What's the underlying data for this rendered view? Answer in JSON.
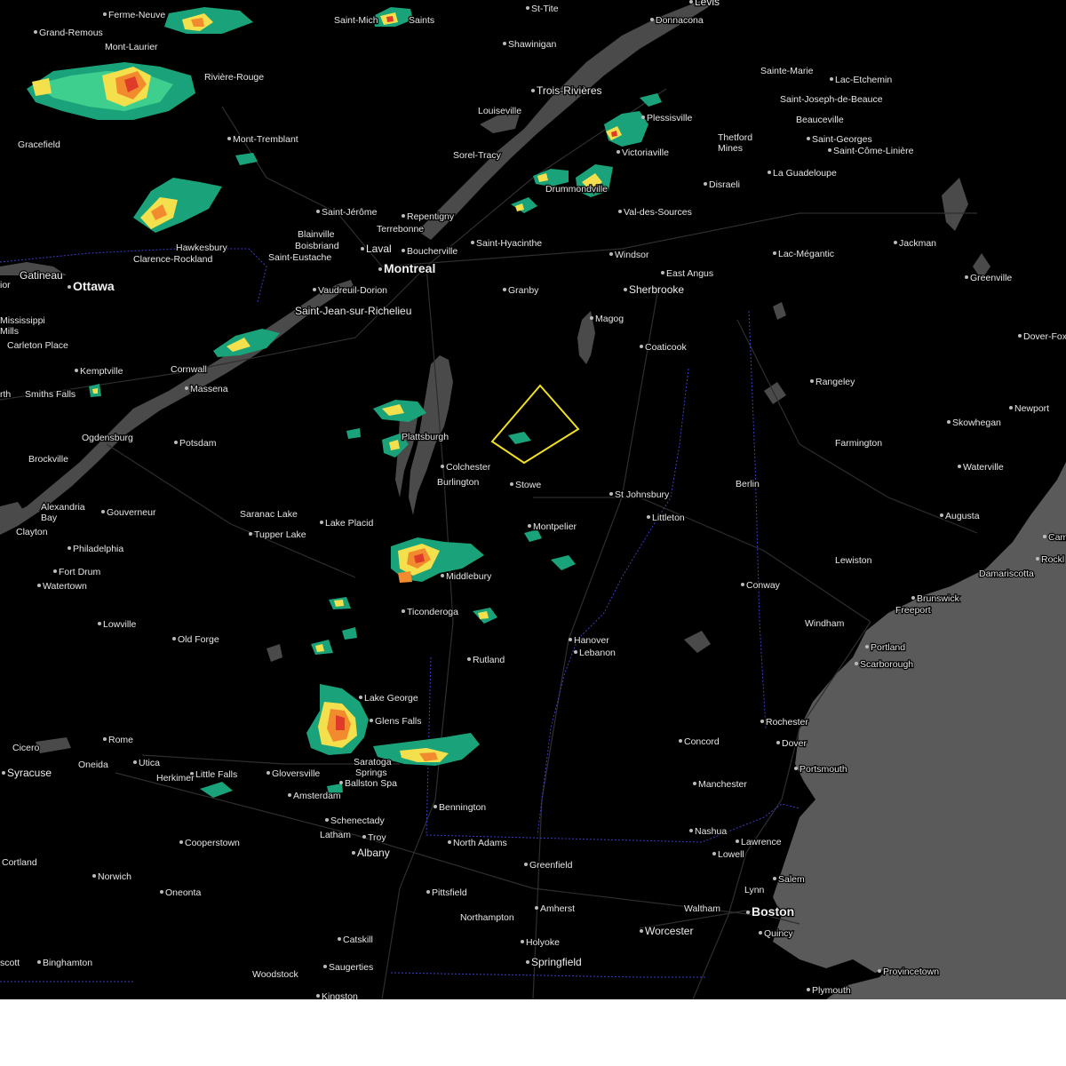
{
  "map": {
    "warning_polygon_color": "#f0e020",
    "radar_palette": {
      "light": "#1aa37a",
      "mid": "#3ecf8e",
      "yellow": "#f4e04d",
      "orange": "#f28a2e",
      "red": "#e03a2a"
    },
    "colors": {
      "land": "#000000",
      "ocean": "#5a5a5a",
      "water": "#4a4a4a",
      "roads": "#3a3a3a",
      "border": "#3c3cc8"
    }
  },
  "places": [
    {
      "id": "levis",
      "name": "Levis"
    },
    {
      "id": "ferme-neuve",
      "name": "Ferme-Neuve"
    },
    {
      "id": "saint-michel",
      "name": "Saint-Mich"
    },
    {
      "id": "saints",
      "name": "Saints"
    },
    {
      "id": "st-tite",
      "name": "St-Tite"
    },
    {
      "id": "donnacona",
      "name": "Donnacona"
    },
    {
      "id": "grand-remous",
      "name": "Grand-Remous"
    },
    {
      "id": "mont-laurier",
      "name": "Mont-Laurier"
    },
    {
      "id": "shawinigan",
      "name": "Shawinigan"
    },
    {
      "id": "sainte-marie",
      "name": "Sainte-Marie"
    },
    {
      "id": "lac-etchemin",
      "name": "Lac-Etchemin"
    },
    {
      "id": "riviere-rouge",
      "name": "Rivière-Rouge"
    },
    {
      "id": "trois-rivieres",
      "name": "Trois-Rivières"
    },
    {
      "id": "saint-joseph",
      "name": "Saint-Joseph-de-Beauce"
    },
    {
      "id": "louiseville",
      "name": "Louiseville"
    },
    {
      "id": "plessisville",
      "name": "Plessisville"
    },
    {
      "id": "beauceville",
      "name": "Beauceville"
    },
    {
      "id": "mont-tremblant",
      "name": "Mont-Tremblant"
    },
    {
      "id": "thetford",
      "name": "Thetford"
    },
    {
      "id": "mines",
      "name": "Mines"
    },
    {
      "id": "saint-georges",
      "name": "Saint-Georges"
    },
    {
      "id": "gracefield",
      "name": "Gracefield"
    },
    {
      "id": "saint-come",
      "name": "Saint-Côme-Linière"
    },
    {
      "id": "victoriaville",
      "name": "Victoriaville"
    },
    {
      "id": "sorel-tracy",
      "name": "Sorel-Tracy"
    },
    {
      "id": "la-guadeloupe",
      "name": "La Guadeloupe"
    },
    {
      "id": "drummondville",
      "name": "Drummondville"
    },
    {
      "id": "disraeli",
      "name": "Disraeli"
    },
    {
      "id": "saint-jerome",
      "name": "Saint-Jérôme"
    },
    {
      "id": "val-des-sources",
      "name": "Val-des-Sources"
    },
    {
      "id": "repentigny",
      "name": "Repentigny"
    },
    {
      "id": "terrebonne",
      "name": "Terrebonne"
    },
    {
      "id": "blainville",
      "name": "Blainville"
    },
    {
      "id": "saint-hyacinthe",
      "name": "Saint-Hyacinthe"
    },
    {
      "id": "boisbriand",
      "name": "Boisbriand"
    },
    {
      "id": "laval",
      "name": "Laval"
    },
    {
      "id": "boucherville",
      "name": "Boucherville"
    },
    {
      "id": "hawkesbury",
      "name": "Hawkesbury"
    },
    {
      "id": "jackman",
      "name": "Jackman"
    },
    {
      "id": "windsor",
      "name": "Windsor"
    },
    {
      "id": "lac-megantic",
      "name": "Lac-Mégantic"
    },
    {
      "id": "clarence-rockland",
      "name": "Clarence-Rockland"
    },
    {
      "id": "saint-eustache",
      "name": "Saint-Eustache"
    },
    {
      "id": "gatineau",
      "name": "Gatineau"
    },
    {
      "id": "montreal",
      "name": "Montreal"
    },
    {
      "id": "east-angus",
      "name": "East Angus"
    },
    {
      "id": "greenville",
      "name": "Greenville"
    },
    {
      "id": "ottawa",
      "name": "Ottawa"
    },
    {
      "id": "vaudreuil",
      "name": "Vaudreuil-Dorion"
    },
    {
      "id": "granby",
      "name": "Granby"
    },
    {
      "id": "sherbrooke",
      "name": "Sherbrooke"
    },
    {
      "id": "ior",
      "name": "ior"
    },
    {
      "id": "saint-jean",
      "name": "Saint-Jean-sur-Richelieu"
    },
    {
      "id": "magog",
      "name": "Magog"
    },
    {
      "id": "mississippi",
      "name": "Mississippi"
    },
    {
      "id": "mills",
      "name": "Mills"
    },
    {
      "id": "dover-fox",
      "name": "Dover-Fox"
    },
    {
      "id": "carleton-place",
      "name": "Carleton Place"
    },
    {
      "id": "coaticook",
      "name": "Coaticook"
    },
    {
      "id": "kemptville",
      "name": "Kemptville"
    },
    {
      "id": "cornwall",
      "name": "Cornwall"
    },
    {
      "id": "rangeley",
      "name": "Rangeley"
    },
    {
      "id": "massena",
      "name": "Massena"
    },
    {
      "id": "rth",
      "name": "rth"
    },
    {
      "id": "smiths-falls",
      "name": "Smiths Falls"
    },
    {
      "id": "newport",
      "name": "Newport"
    },
    {
      "id": "skowhegan",
      "name": "Skowhegan"
    },
    {
      "id": "ogdensburg",
      "name": "Ogdensburg"
    },
    {
      "id": "plattsburgh",
      "name": "Plattsburgh"
    },
    {
      "id": "potsdam",
      "name": "Potsdam"
    },
    {
      "id": "farmington",
      "name": "Farmington"
    },
    {
      "id": "brockville",
      "name": "Brockville"
    },
    {
      "id": "colchester",
      "name": "Colchester"
    },
    {
      "id": "waterville",
      "name": "Waterville"
    },
    {
      "id": "burlington",
      "name": "Burlington"
    },
    {
      "id": "stowe",
      "name": "Stowe"
    },
    {
      "id": "berlin",
      "name": "Berlin"
    },
    {
      "id": "alexandria",
      "name": "Alexandria"
    },
    {
      "id": "bay",
      "name": "Bay"
    },
    {
      "id": "gouverneur",
      "name": "Gouverneur"
    },
    {
      "id": "st-johnsbury",
      "name": "St Johnsbury"
    },
    {
      "id": "saranac-lake",
      "name": "Saranac Lake"
    },
    {
      "id": "augusta",
      "name": "Augusta"
    },
    {
      "id": "littleton",
      "name": "Littleton"
    },
    {
      "id": "lake-placid",
      "name": "Lake Placid"
    },
    {
      "id": "clayton",
      "name": "Clayton"
    },
    {
      "id": "tupper-lake",
      "name": "Tupper Lake"
    },
    {
      "id": "montpelier",
      "name": "Montpelier"
    },
    {
      "id": "cam",
      "name": "Cam"
    },
    {
      "id": "philadelphia",
      "name": "Philadelphia"
    },
    {
      "id": "rockl",
      "name": "Rockl"
    },
    {
      "id": "lewiston",
      "name": "Lewiston"
    },
    {
      "id": "fort-drum",
      "name": "Fort Drum"
    },
    {
      "id": "middlebury",
      "name": "Middlebury"
    },
    {
      "id": "damariscotta",
      "name": "Damariscotta"
    },
    {
      "id": "watertown",
      "name": "Watertown"
    },
    {
      "id": "conway",
      "name": "Conway"
    },
    {
      "id": "brunswick",
      "name": "Brunswick"
    },
    {
      "id": "ticonderoga",
      "name": "Ticonderoga"
    },
    {
      "id": "freeport",
      "name": "Freeport"
    },
    {
      "id": "windham",
      "name": "Windham"
    },
    {
      "id": "lowville",
      "name": "Lowville"
    },
    {
      "id": "hanover",
      "name": "Hanover"
    },
    {
      "id": "old-forge",
      "name": "Old Forge"
    },
    {
      "id": "lebanon",
      "name": "Lebanon"
    },
    {
      "id": "portland",
      "name": "Portland"
    },
    {
      "id": "rutland",
      "name": "Rutland"
    },
    {
      "id": "scarborough",
      "name": "Scarborough"
    },
    {
      "id": "lake-george",
      "name": "Lake George"
    },
    {
      "id": "glens-falls",
      "name": "Glens Falls"
    },
    {
      "id": "rochester",
      "name": "Rochester"
    },
    {
      "id": "rome",
      "name": "Rome"
    },
    {
      "id": "concord",
      "name": "Concord"
    },
    {
      "id": "dover",
      "name": "Dover"
    },
    {
      "id": "cicero",
      "name": "Cicero"
    },
    {
      "id": "utica",
      "name": "Utica"
    },
    {
      "id": "oneida",
      "name": "Oneida"
    },
    {
      "id": "saratoga",
      "name": "Saratoga"
    },
    {
      "id": "springs",
      "name": "Springs"
    },
    {
      "id": "portsmouth",
      "name": "Portsmouth"
    },
    {
      "id": "syracuse",
      "name": "Syracuse"
    },
    {
      "id": "gloversville",
      "name": "Gloversville"
    },
    {
      "id": "little-falls",
      "name": "Little Falls"
    },
    {
      "id": "herkimer",
      "name": "Herkimer"
    },
    {
      "id": "ballston-spa",
      "name": "Ballston Spa"
    },
    {
      "id": "manchester",
      "name": "Manchester"
    },
    {
      "id": "amsterdam",
      "name": "Amsterdam"
    },
    {
      "id": "bennington",
      "name": "Bennington"
    },
    {
      "id": "schenectady",
      "name": "Schenectady"
    },
    {
      "id": "nashua",
      "name": "Nashua"
    },
    {
      "id": "latham",
      "name": "Latham"
    },
    {
      "id": "troy",
      "name": "Troy"
    },
    {
      "id": "cooperstown",
      "name": "Cooperstown"
    },
    {
      "id": "north-adams",
      "name": "North Adams"
    },
    {
      "id": "lawrence",
      "name": "Lawrence"
    },
    {
      "id": "albany",
      "name": "Albany"
    },
    {
      "id": "lowell",
      "name": "Lowell"
    },
    {
      "id": "cortland",
      "name": "Cortland"
    },
    {
      "id": "greenfield",
      "name": "Greenfield"
    },
    {
      "id": "norwich",
      "name": "Norwich"
    },
    {
      "id": "salem",
      "name": "Salem"
    },
    {
      "id": "oneonta",
      "name": "Oneonta"
    },
    {
      "id": "pittsfield",
      "name": "Pittsfield"
    },
    {
      "id": "amherst",
      "name": "Amherst"
    },
    {
      "id": "lynn",
      "name": "Lynn"
    },
    {
      "id": "waltham",
      "name": "Waltham"
    },
    {
      "id": "boston",
      "name": "Boston"
    },
    {
      "id": "northampton",
      "name": "Northampton"
    },
    {
      "id": "worcester",
      "name": "Worcester"
    },
    {
      "id": "quincy",
      "name": "Quincy"
    },
    {
      "id": "catskill",
      "name": "Catskill"
    },
    {
      "id": "holyoke",
      "name": "Holyoke"
    },
    {
      "id": "springfield",
      "name": "Springfield"
    },
    {
      "id": "binghamton",
      "name": "Binghamton"
    },
    {
      "id": "scott",
      "name": "scott"
    },
    {
      "id": "saugerties",
      "name": "Saugerties"
    },
    {
      "id": "provincetown",
      "name": "Provincetown"
    },
    {
      "id": "woodstock",
      "name": "Woodstock"
    },
    {
      "id": "plymouth",
      "name": "Plymouth"
    },
    {
      "id": "kingston",
      "name": "Kingston"
    }
  ]
}
